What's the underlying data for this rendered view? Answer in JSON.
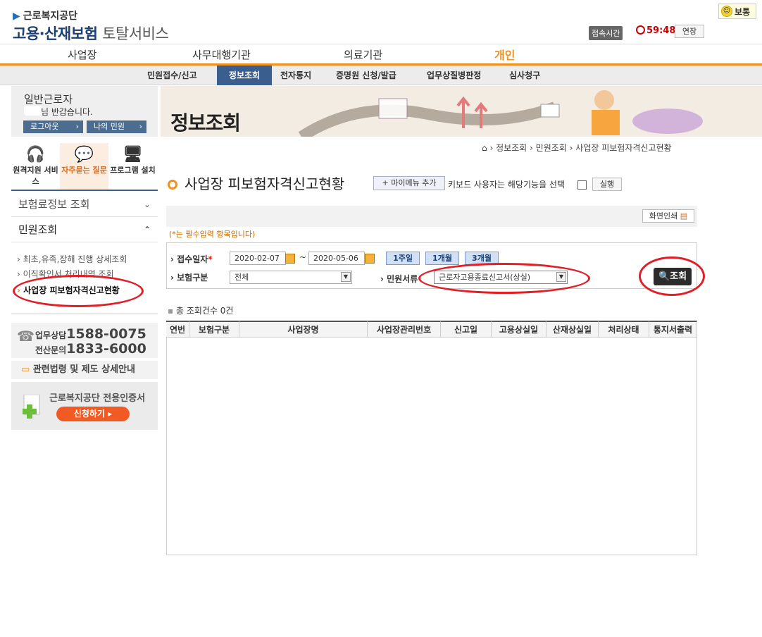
{
  "header": {
    "agency": "근로복지공단",
    "service_main": "고용·산재보험",
    "service_sub": "토탈서비스",
    "mood": "보통",
    "session_label": "접속시간",
    "session_time": "59:48",
    "extend_label": "연장"
  },
  "top_nav": [
    "사업장",
    "사무대행기관",
    "의료기관",
    "개인"
  ],
  "sub_nav": [
    "민원접수/신고",
    "정보조회",
    "전자통지",
    "증명원 신청/발급",
    "업무상질병판정",
    "심사청구"
  ],
  "sidebar": {
    "user_type": "일반근로자",
    "greeting": "님 반갑습니다.",
    "logout": "로그아웃",
    "my_civil": "나의 민원",
    "quick": [
      {
        "icon": "headset-icon",
        "label": "원격지원 서비스"
      },
      {
        "icon": "chat-icon",
        "label": "자주묻는 질문"
      },
      {
        "icon": "monitor-icon",
        "label": "프로그램 설치"
      }
    ],
    "menu_insurance": "보험료정보 조회",
    "menu_civil": "민원조회",
    "sub_items": [
      "최초,유족,장해 진행 상세조회",
      "이직확인서 처리내역 조회",
      "사업장 피보험자격신고현황"
    ],
    "phone_label1": "업무상담",
    "phone_num1": "1588-0075",
    "phone_label2": "전산문의",
    "phone_num2": "1833-6000",
    "law_link": "관련법령 및 제도 상세안내",
    "cert_text": "근로복지공단 전용인증서",
    "cert_button": "신청하기"
  },
  "main": {
    "page_title": "정보조회",
    "breadcrumb": [
      "정보조회",
      "민원조회",
      "사업장 피보험자격신고현황"
    ],
    "section_title": "사업장 피보험자격신고현황",
    "mymenu_button": "+ 마이메뉴 추가",
    "kb_text": "키보드 사용자는 해당기능을 선택",
    "run_button": "실행",
    "print_button": "화면인쇄",
    "required_note": "(*는 필수입력 항목입니다)",
    "form": {
      "date_label": "접수일자",
      "date_from": "2020-02-07",
      "date_to": "2020-05-06",
      "tilde": "~",
      "period_buttons": [
        "1주일",
        "1개월",
        "3개월"
      ],
      "insurance_label": "보험구분",
      "insurance_value": "전체",
      "doc_label": "민원서류",
      "doc_value": "근로자고용종료신고서(상실)",
      "search_button": "조회"
    },
    "total_count": "총 조회건수 0건",
    "table_headers": [
      "연번",
      "보험구분",
      "사업장명",
      "사업장관리번호",
      "신고일",
      "고용상실일",
      "산재상실일",
      "처리상태",
      "통지서출력"
    ]
  },
  "colors": {
    "accent": "#f0901f",
    "nav_active": "#3a5f8f",
    "annotation": "#e01f26"
  }
}
